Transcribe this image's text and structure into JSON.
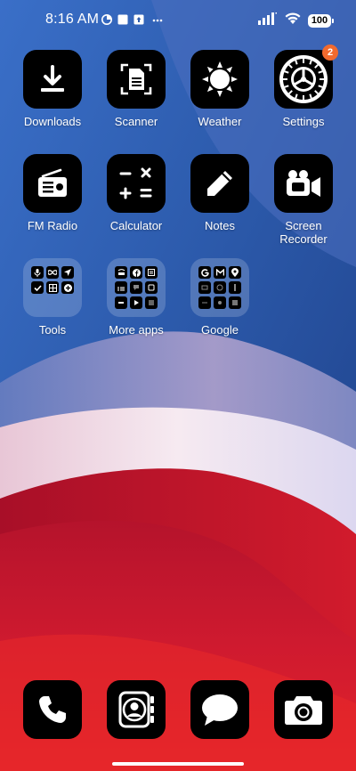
{
  "status_bar": {
    "time": "8:16 AM",
    "battery": "100",
    "icons": [
      "data-saver-icon",
      "square-notification-icon",
      "upload-notification-icon",
      "more-dots-icon",
      "signal-icon",
      "wifi-icon"
    ]
  },
  "apps": [
    {
      "label": "Downloads",
      "icon": "download-icon"
    },
    {
      "label": "Scanner",
      "icon": "document-scan-icon"
    },
    {
      "label": "Weather",
      "icon": "sun-icon"
    },
    {
      "label": "Settings",
      "icon": "gear-icon",
      "badge": "2"
    },
    {
      "label": "FM Radio",
      "icon": "radio-icon"
    },
    {
      "label": "Calculator",
      "icon": "calculator-icon"
    },
    {
      "label": "Notes",
      "icon": "pencil-icon"
    },
    {
      "label": "Screen Recorder",
      "label_line1": "Screen",
      "label_line2": "Recorder",
      "icon": "video-camera-icon"
    }
  ],
  "folders": [
    {
      "label": "Tools"
    },
    {
      "label": "More apps"
    },
    {
      "label": "Google"
    }
  ],
  "dock": [
    {
      "name": "Phone",
      "icon": "phone-icon"
    },
    {
      "name": "Contacts",
      "icon": "contacts-icon"
    },
    {
      "name": "Messages",
      "icon": "message-bubble-icon"
    },
    {
      "name": "Camera",
      "icon": "camera-icon"
    }
  ],
  "colors": {
    "badge": "#f26a2e",
    "tile": "#000000",
    "wallpaper_blue": "#2f5fb8",
    "wallpaper_red": "#c8102e",
    "wallpaper_pink": "#f2e4ee"
  }
}
